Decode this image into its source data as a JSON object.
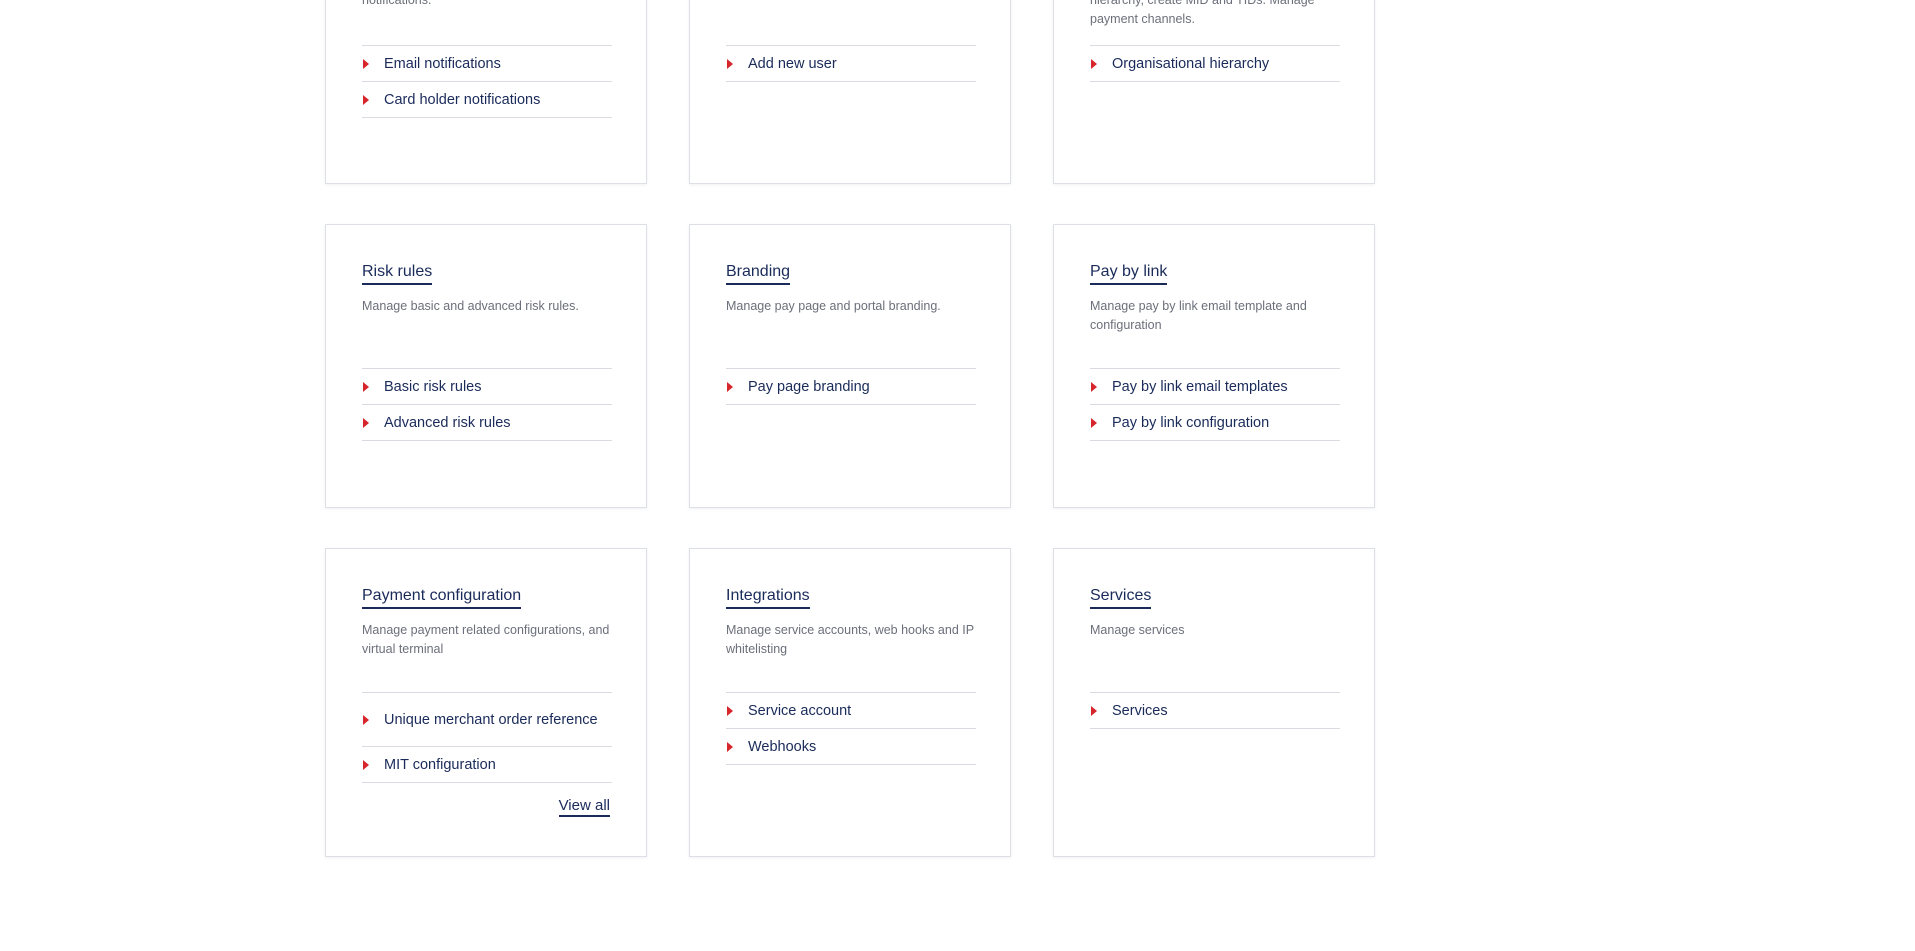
{
  "row1": {
    "notifications": {
      "desc": "notifications.",
      "links": [
        "Email notifications",
        "Card holder notifications"
      ]
    },
    "users": {
      "links": [
        "Add new user"
      ]
    },
    "hierarchy": {
      "desc": "hierarchy, create MID and TIDs. Manage payment channels.",
      "links": [
        "Organisational hierarchy"
      ]
    }
  },
  "risk_rules": {
    "title": "Risk rules",
    "desc": "Manage basic and advanced risk rules.",
    "links": [
      "Basic risk rules",
      "Advanced risk rules"
    ]
  },
  "branding": {
    "title": "Branding",
    "desc": "Manage pay page and portal branding.",
    "links": [
      "Pay page branding"
    ]
  },
  "pay_by_link": {
    "title": "Pay by link",
    "desc": "Manage pay by link email template and configuration",
    "links": [
      "Pay by link email templates",
      "Pay by link configuration"
    ]
  },
  "payment_configuration": {
    "title": "Payment configuration",
    "desc": "Manage payment related configurations, and virtual terminal",
    "links": [
      "Unique merchant order reference",
      "MIT configuration"
    ],
    "view_all": "View all"
  },
  "integrations": {
    "title": "Integrations",
    "desc": "Manage service accounts, web hooks and IP whitelisting",
    "links": [
      "Service account",
      "Webhooks"
    ]
  },
  "services": {
    "title": "Services",
    "desc": "Manage services",
    "links": [
      "Services"
    ]
  },
  "colors": {
    "accent_arrow": "#d7262b",
    "text_primary": "#1a2b5a",
    "text_secondary": "#6b6f7a"
  }
}
